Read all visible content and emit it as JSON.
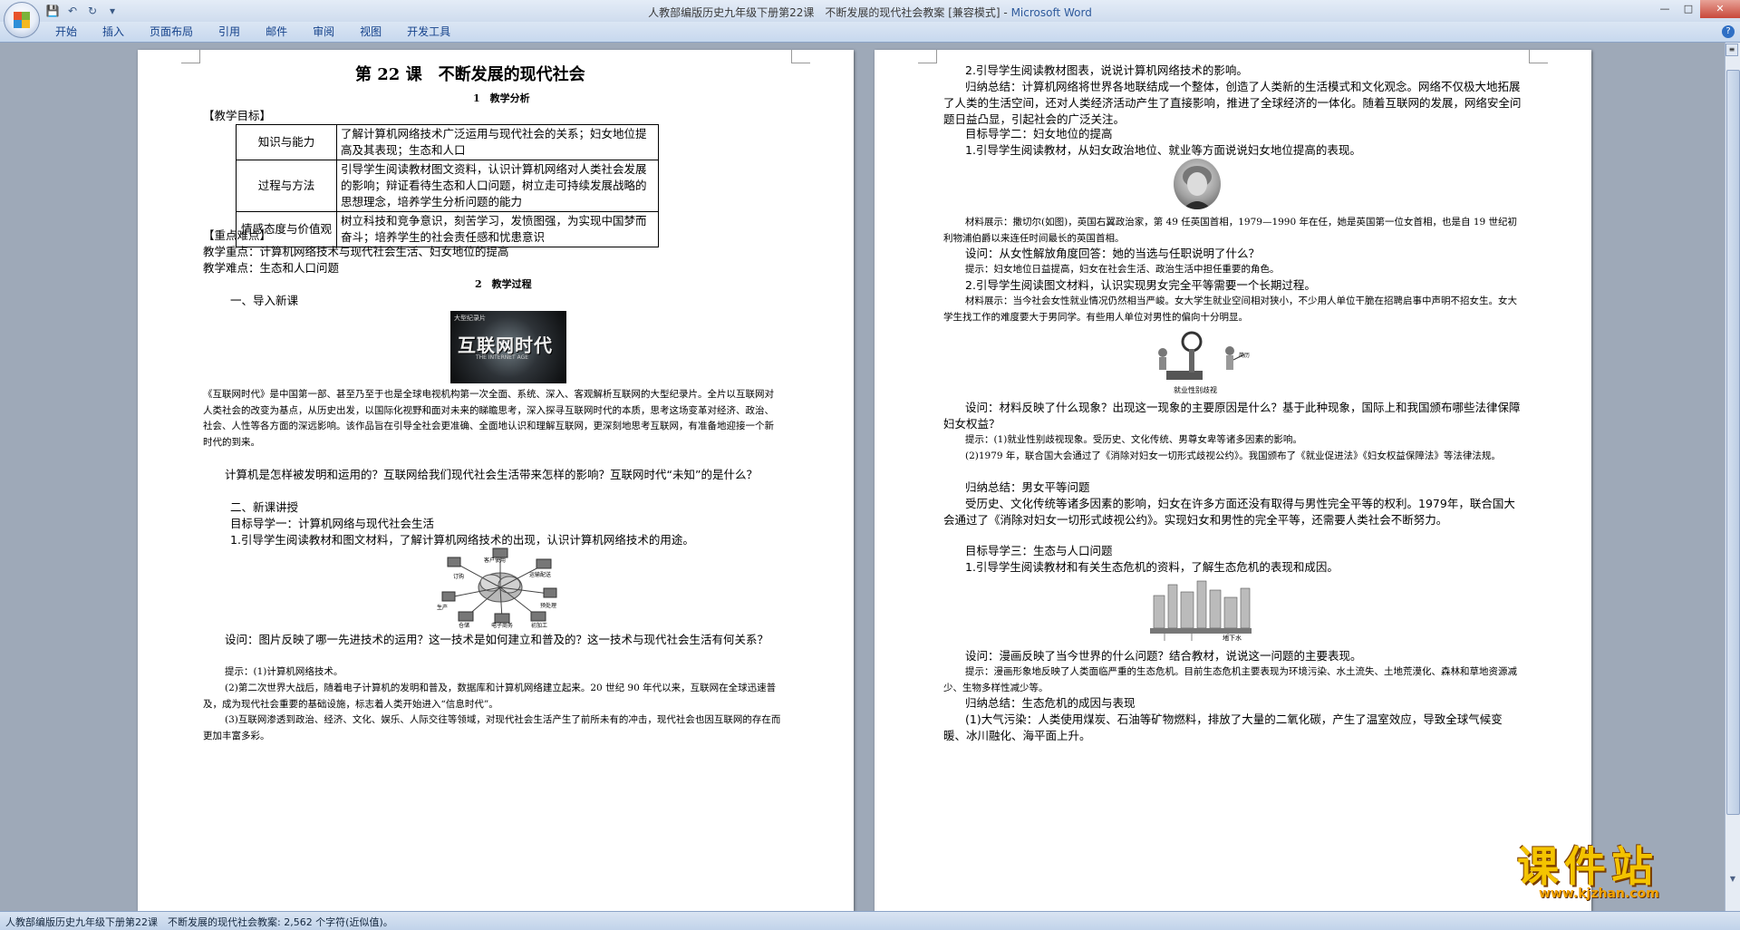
{
  "window": {
    "title": "人教部编版历史九年级下册第22课　不断发展的现代社会教案 [兼容模式] - ",
    "app_name": "Microsoft Word"
  },
  "ribbon": {
    "tabs": [
      "开始",
      "插入",
      "页面布局",
      "引用",
      "邮件",
      "审阅",
      "视图",
      "开发工具"
    ]
  },
  "status_bar": {
    "text": "人教部编版历史九年级下册第22课　不断发展的现代社会教案: 2,562 个字符(近似值)。"
  },
  "watermark": {
    "main": "课件站",
    "url": "www.kjzhan.com"
  },
  "left_page": {
    "title": "第 22 课　不断发展的现代社会",
    "section1": "1　教学分析",
    "objectives_heading": "【教学目标】",
    "objectives": [
      {
        "label": "知识与能力",
        "text": "了解计算机网络技术广泛运用与现代社会的关系；妇女地位提高及其表现；生态和人口"
      },
      {
        "label": "过程与方法",
        "text": "引导学生阅读教材图文资料，认识计算机网络对人类社会发展的影响；辩证看待生态和人口问题，树立走可持续发展战略的思想理念，培养学生分析问题的能力"
      },
      {
        "label": "情感态度与价值观",
        "text": "树立科技和竞争意识，刻苦学习，发愤图强，为实现中国梦而奋斗；培养学生的社会责任感和忧患意识"
      }
    ],
    "key_heading": "【重点难点】",
    "key_point": "教学重点：计算机网络技术与现代社会生活、妇女地位的提高",
    "difficult_point": "教学难点：生态和人口问题",
    "section2": "2　教学过程",
    "intro": "一、导入新课",
    "image1_text": "互联网时代",
    "image1_sub": "THE INTERNET AGE",
    "image1_top": "大型纪录片",
    "para_doc": "《互联网时代》是中国第一部、甚至乃至于也是全球电视机构第一次全面、系统、深入、客观解析互联网的大型纪录片。全片以互联网对人类社会的改变为基点，从历史出发，以国际化视野和面对未来的睇瞻思考，深入探寻互联网时代的本质，思考这场变革对经济、政治、社会、人性等各方面的深远影响。该作品旨在引导全社会更准确、全面地认识和理解互联网，更深刻地思考互联网，有准备地迎接一个新时代的到来。",
    "para_question": "计算机是怎样被发明和运用的？互联网给我们现代社会生活带来怎样的影响？互联网时代“未知”的是什么？",
    "new_lesson": "二、新课讲授",
    "target1": "目标导学一：计算机网络与现代社会生活",
    "step1": "1.引导学生阅读教材和图文材料，了解计算机网络技术的出现，认识计算机网络技术的用途。",
    "diagram_labels": [
      "客户使用",
      "订购",
      "运输配送",
      "生产",
      "预处理",
      "仓储",
      "电子商务",
      "初加工"
    ],
    "q1": "设问：图片反映了哪一先进技术的运用？这一技术是如何建立和普及的？这一技术与现代社会生活有何关系？",
    "hint1": "提示：(1)计算机网络技术。",
    "hint2": "(2)第二次世界大战后，随着电子计算机的发明和普及，数据库和计算机网络建立起来。20 世纪 90 年代以来，互联网在全球迅速普及，成为现代社会重要的基础设施，标志着人类开始进入“信息时代”。",
    "hint3": "(3)互联网渗透到政治、经济、文化、娱乐、人际交往等领域，对现代社会生活产生了前所未有的冲击，现代社会也因互联网的存在而更加丰富多彩。"
  },
  "right_page": {
    "step2": "2.引导学生阅读教材图表，说说计算机网络技术的影响。",
    "summary1": "归纳总结：计算机网络将世界各地联结成一个整体，创造了人类新的生活模式和文化观念。网络不仅极大地拓展了人类的生活空间，还对人类经济活动产生了直接影响，推进了全球经济的一体化。随着互联网的发展，网络安全问题日益凸显，引起社会的广泛关注。",
    "target2": "目标导学二：妇女地位的提高",
    "step3": "1.引导学生阅读教材，从妇女政治地位、就业等方面说说妇女地位提高的表现。",
    "material1": "材料展示：撒切尔(如图)，英国右翼政治家，第 49 任英国首相，1979—1990 年在任，她是英国第一位女首相，也是自 19 世纪初利物浦伯爵以来连任时间最长的英国首相。",
    "q2": "设问：从女性解放角度回答：她的当选与任职说明了什么？",
    "hint4": "提示：妇女地位日益提高，妇女在社会生活、政治生活中担任重要的角色。",
    "step4": "2.引导学生阅读图文材料，认识实现男女完全平等需要一个长期过程。",
    "material2": "材料展示：当今社会女性就业情况仍然相当严峻。女大学生就业空间相对狭小，不少用人单位干脆在招聘启事中声明不招女生。女大学生找工作的难度要大于男同学。有些用人单位对男性的偏向十分明显。",
    "cartoon_caption": "就业性别歧视",
    "cartoon_tag": "简历",
    "q3": "设问：材料反映了什么现象？出现这一现象的主要原因是什么？基于此种现象，国际上和我国颁布哪些法律保障妇女权益？",
    "hint5": "提示：(1)就业性别歧视现象。受历史、文化传统、男尊女卑等诸多因素的影响。",
    "hint6": "(2)1979 年，联合国大会通过了《消除对妇女一切形式歧视公约》。我国颁布了《就业促进法》《妇女权益保障法》等法律法规。",
    "summary2": "归纳总结：男女平等问题",
    "para_equal": "受历史、文化传统等诸多因素的影响，妇女在许多方面还没有取得与男性完全平等的权利。1979年，联合国大会通过了《消除对妇女一切形式歧视公约》。实现妇女和男性的完全平等，还需要人类社会不断努力。",
    "target3": "目标导学三：生态与人口问题",
    "step5": "1.引导学生阅读教材和有关生态危机的资料，了解生态危机的表现和成因。",
    "city_caption": "地下水",
    "q4": "设问：漫画反映了当今世界的什么问题？结合教材，说说这一问题的主要表现。",
    "hint7": "提示：漫画形象地反映了人类面临严重的生态危机。目前生态危机主要表现为环境污染、水土流失、土地荒漠化、森林和草地资源减少、生物多样性减少等。",
    "summary3": "归纳总结：生态危机的成因与表现",
    "para_air": "(1)大气污染：人类使用煤炭、石油等矿物燃料，排放了大量的二氧化碳，产生了温室效应，导致全球气候变暖、冰川融化、海平面上升。"
  },
  "colors": {
    "title_bar": "#d7e3f3",
    "ribbon_text": "#15428b",
    "workspace": "#9ea9b8",
    "watermark": "#f4c400"
  }
}
